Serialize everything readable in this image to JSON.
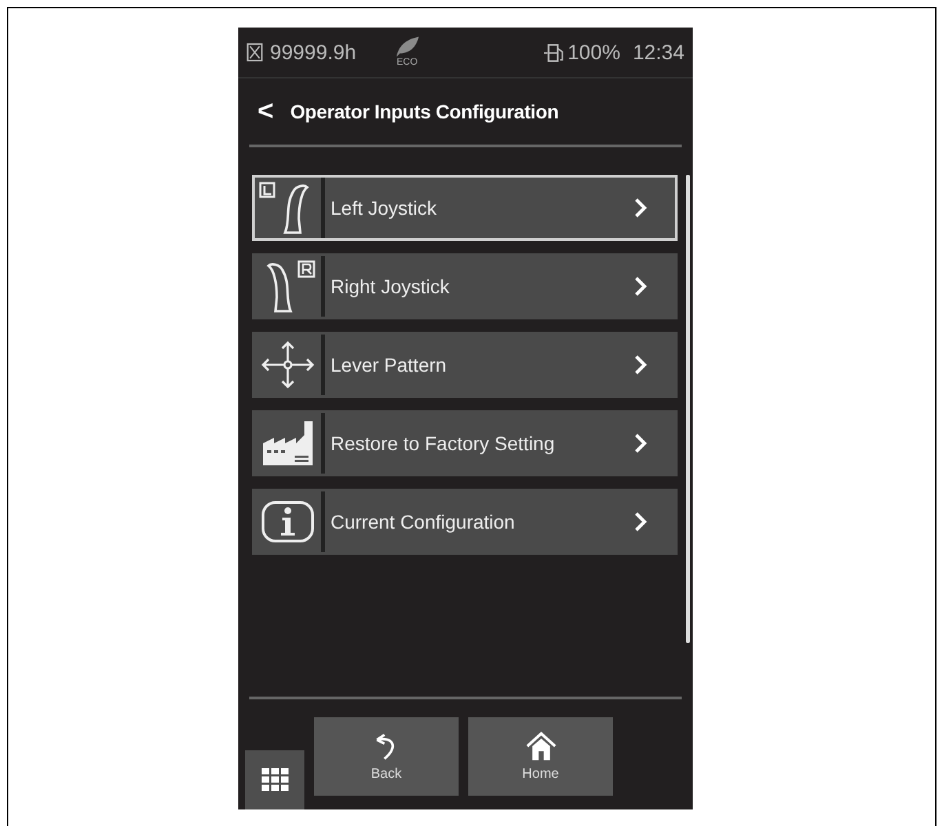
{
  "status_bar": {
    "hours": "99999.9h",
    "eco_label": "ECO",
    "fuel": "100%",
    "time": "12:34"
  },
  "header": {
    "back_glyph": "<",
    "title": "Operator Inputs Configuration"
  },
  "menu": [
    {
      "kind": "left-joystick",
      "label": "Left Joystick",
      "selected": true
    },
    {
      "kind": "right-joystick",
      "label": "Right Joystick",
      "selected": false
    },
    {
      "kind": "lever-pattern",
      "label": "Lever Pattern",
      "selected": false
    },
    {
      "kind": "factory",
      "label": "Restore to Factory Setting",
      "selected": false
    },
    {
      "kind": "info",
      "label": "Current Configuration",
      "selected": false
    }
  ],
  "footer": {
    "buttons": [
      {
        "kind": "back",
        "label": "Back"
      },
      {
        "kind": "home",
        "label": "Home"
      }
    ]
  }
}
